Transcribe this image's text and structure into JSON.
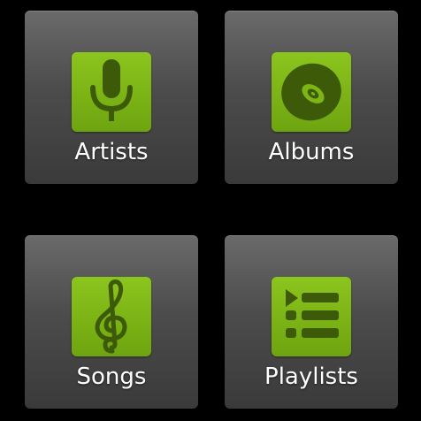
{
  "library": {
    "tiles": [
      {
        "label": "Artists",
        "icon": "microphone-icon"
      },
      {
        "label": "Albums",
        "icon": "disc-icon"
      },
      {
        "label": "Songs",
        "icon": "treble-clef-icon"
      },
      {
        "label": "Playlists",
        "icon": "playlist-icon"
      }
    ]
  },
  "colors": {
    "background": "#000000",
    "tile": "#4c4c4c",
    "icon_accent": "#7db515",
    "icon_glyph": "#3d5a08",
    "label": "#ffffff"
  }
}
